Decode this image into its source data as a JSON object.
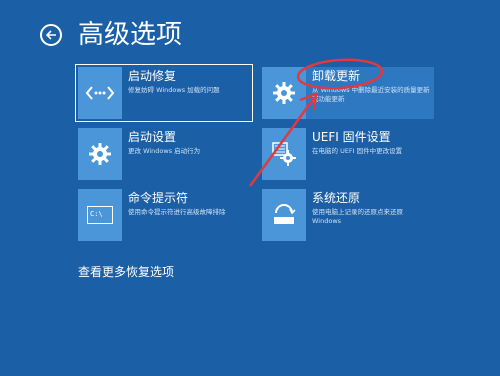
{
  "header": {
    "title": "高级选项",
    "back_icon": "back-arrow-icon"
  },
  "tiles": [
    {
      "label": "启动修复",
      "desc": "修复妨碍 Windows 加载的问题",
      "icon": "code-brackets-icon"
    },
    {
      "label": "卸载更新",
      "desc": "从 Windows 中删除最近安装的质量更新或功能更新",
      "icon": "gear-icon"
    },
    {
      "label": "启动设置",
      "desc": "更改 Windows 启动行为",
      "icon": "gear-icon"
    },
    {
      "label": "UEFI 固件设置",
      "desc": "在电脑的 UEFI 固件中更改设置",
      "icon": "firmware-gear-icon"
    },
    {
      "label": "命令提示符",
      "desc": "使用命令提示符进行高级故障排除",
      "icon": "command-prompt-icon"
    },
    {
      "label": "系统还原",
      "desc": "使用电脑上记录的还原点来还原 Windows",
      "icon": "system-restore-icon"
    }
  ],
  "cmd_icon_text": "C:\\",
  "more_link": "查看更多恢复选项",
  "colors": {
    "background": "#1b5fa6",
    "tile_icon_bg": "#4a96d8",
    "annotation": "#e0393e"
  }
}
